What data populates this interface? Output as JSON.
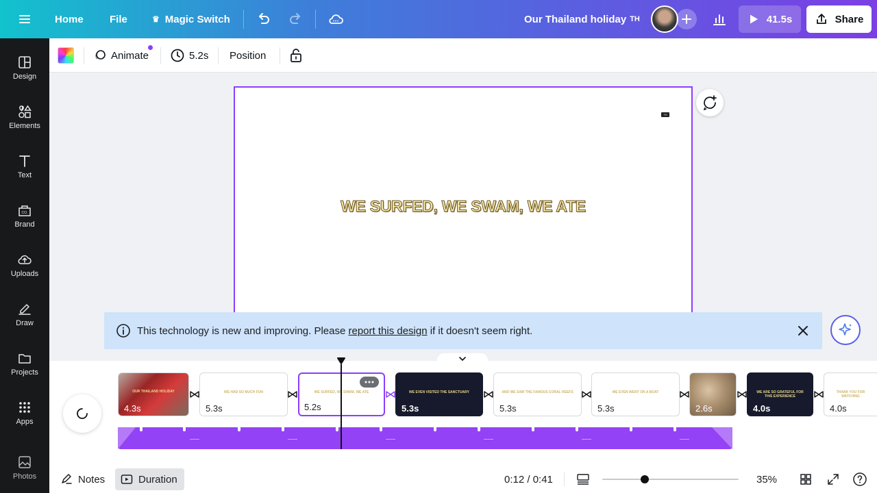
{
  "topbar": {
    "home": "Home",
    "file": "File",
    "magic_switch": "Magic Switch",
    "doc_title": "Our Thailand holiday",
    "doc_title_mark": "TH",
    "play_time": "41.5s",
    "share": "Share"
  },
  "sidebar": {
    "items": [
      {
        "label": "Design",
        "icon": "design-icon"
      },
      {
        "label": "Elements",
        "icon": "elements-icon"
      },
      {
        "label": "Text",
        "icon": "text-icon"
      },
      {
        "label": "Brand",
        "icon": "brand-icon"
      },
      {
        "label": "Uploads",
        "icon": "uploads-icon"
      },
      {
        "label": "Draw",
        "icon": "draw-icon"
      },
      {
        "label": "Projects",
        "icon": "projects-icon"
      },
      {
        "label": "Apps",
        "icon": "apps-icon"
      },
      {
        "label": "Photos",
        "icon": "photos-icon"
      }
    ]
  },
  "toolbar": {
    "animate": "Animate",
    "duration": "5.2s",
    "position": "Position"
  },
  "canvas": {
    "headline": "WE SURFED, WE SWAM, WE ATE",
    "corner_mark": "TH"
  },
  "notice": {
    "before": "This technology is new and improving. Please ",
    "link": "report this design",
    "after": " if it doesn't seem right."
  },
  "timeline": {
    "pages": [
      {
        "duration": "4.3s",
        "caption": "OUR THAILAND HOLIDAY",
        "style": "photo-red"
      },
      {
        "duration": "5.3s",
        "caption": "WE HAD SO MUCH FUN",
        "style": "white"
      },
      {
        "duration": "5.2s",
        "caption": "WE SURFED, WE SWAM, WE ATE",
        "style": "white-selected"
      },
      {
        "duration": "5.3s",
        "caption": "WE EVEN VISITED THE SANCTUARY",
        "style": "dark"
      },
      {
        "duration": "5.3s",
        "caption": "AND WE SAW THE FAMOUS CORAL REEFS",
        "style": "white"
      },
      {
        "duration": "5.3s",
        "caption": "WE EVEN WENT ON A BOAT",
        "style": "white"
      },
      {
        "duration": "2.6s",
        "caption": "",
        "style": "photo-rock"
      },
      {
        "duration": "4.0s",
        "caption": "WE ARE SO GRATEFUL FOR THIS EXPERIENCE",
        "style": "dark"
      },
      {
        "duration": "4.0s",
        "caption": "THANK YOU FOR WATCHING",
        "style": "white"
      }
    ]
  },
  "bottombar": {
    "notes": "Notes",
    "duration": "Duration",
    "time": "0:12 / 0:41",
    "zoom": "35%",
    "zoom_level": 0.35
  },
  "colors": {
    "accent": "#8b3dff",
    "sidebar_bg": "#18191b",
    "notice_bg": "#cfe3fb"
  }
}
